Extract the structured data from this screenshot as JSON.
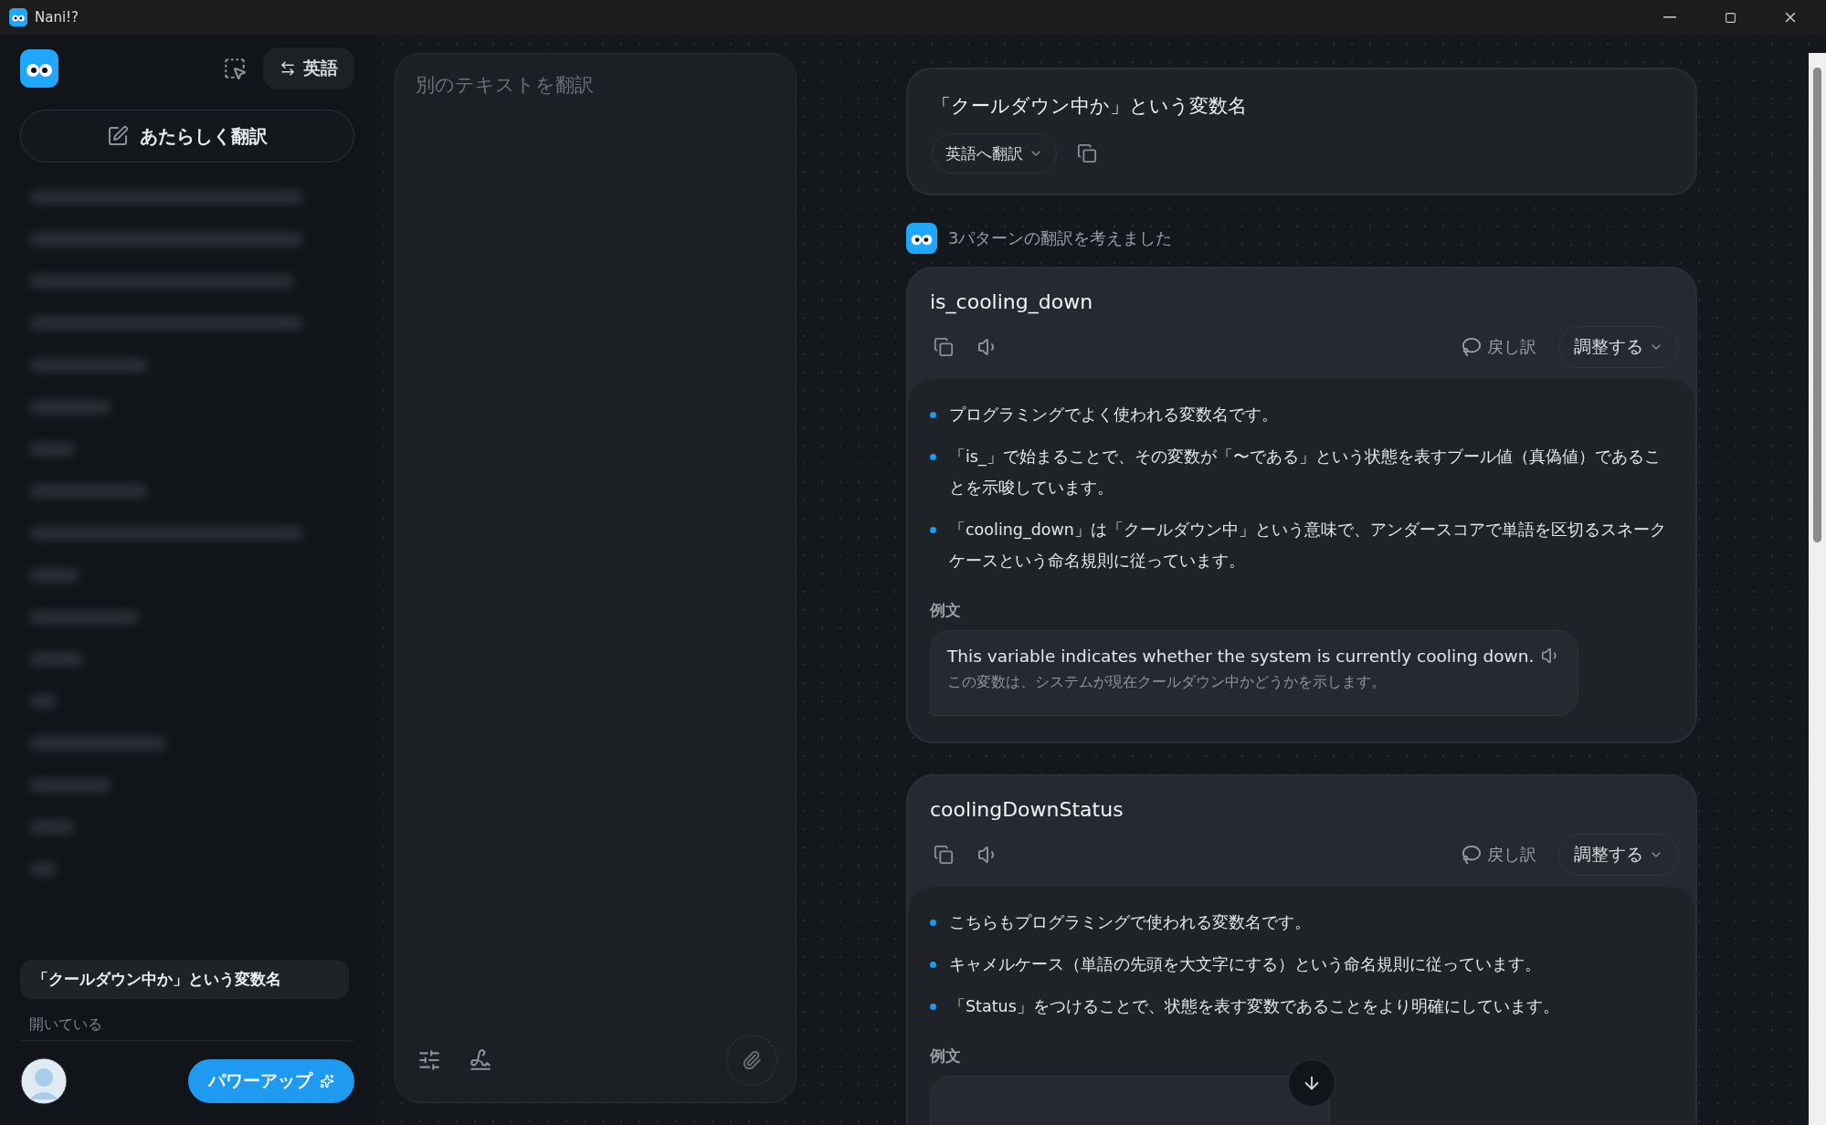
{
  "window": {
    "title": "Nani!?"
  },
  "sidebar": {
    "language_button": "英語",
    "new_translation_button": "あたらしく翻訳",
    "history_items": [
      {
        "title": "「クールダウン中か」という変数名",
        "selected": true
      }
    ],
    "open_label": "開いている",
    "power_up_button": "パワーアップ"
  },
  "input": {
    "placeholder": "別のテキストを翻訳"
  },
  "source": {
    "text": "「クールダウン中か」という変数名",
    "translate_to": "英語へ翻訳"
  },
  "result_summary": "3パターンの翻訳を考えました",
  "translations": [
    {
      "term": "is_cooling_down",
      "back_translation": "戻し訳",
      "adjust": "調整する",
      "notes": [
        "プログラミングでよく使われる変数名です。",
        "「is_」で始まることで、その変数が「〜である」という状態を表すブール値（真偽値）であることを示唆しています。",
        "「cooling_down」は「クールダウン中」という意味で、アンダースコアで単語を区切るスネークケースという命名規則に従っています。"
      ],
      "example_label": "例文",
      "example": {
        "sentence": "This variable indicates whether the system is currently cooling down.",
        "translation": "この変数は、システムが現在クールダウン中かどうかを示します。"
      }
    },
    {
      "term": "coolingDownStatus",
      "back_translation": "戻し訳",
      "adjust": "調整する",
      "notes": [
        "こちらもプログラミングで使われる変数名です。",
        "キャメルケース（単語の先頭を大文字にする）という命名規則に従っています。",
        "「Status」をつけることで、状態を表す変数であることをより明確にしています。"
      ],
      "example_label": "例文"
    }
  ]
}
